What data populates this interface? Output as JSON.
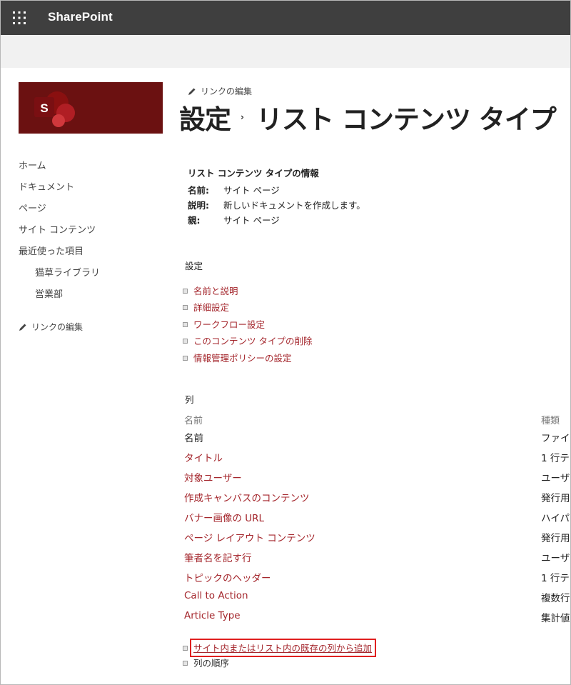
{
  "suite": {
    "app_name": "SharePoint"
  },
  "nav": {
    "items": [
      {
        "label": "ホーム",
        "sub": false
      },
      {
        "label": "ドキュメント",
        "sub": false
      },
      {
        "label": "ページ",
        "sub": false
      },
      {
        "label": "サイト コンテンツ",
        "sub": false
      },
      {
        "label": "最近使った項目",
        "sub": false
      },
      {
        "label": "猫草ライブラリ",
        "sub": true
      },
      {
        "label": "営業部",
        "sub": true
      }
    ],
    "edit_links": "リンクの編集"
  },
  "header": {
    "edit_links": "リンクの編集",
    "breadcrumb_parent": "設定",
    "breadcrumb_separator": "›",
    "breadcrumb_current": "リスト コンテンツ タイプ"
  },
  "info": {
    "title": "リスト コンテンツ タイプの情報",
    "rows": [
      {
        "label": "名前:",
        "value": "サイト ページ"
      },
      {
        "label": "説明:",
        "value": "新しいドキュメントを作成します。"
      },
      {
        "label": "親:",
        "value": "サイト ページ"
      }
    ]
  },
  "settings": {
    "heading": "設定",
    "links": [
      "名前と説明",
      "詳細設定",
      "ワークフロー設定",
      "このコンテンツ タイプの削除",
      "情報管理ポリシーの設定"
    ]
  },
  "columns": {
    "heading": "列",
    "header_name": "名前",
    "header_type": "種類",
    "rows": [
      {
        "name": "名前",
        "type": "ファイル",
        "link": false
      },
      {
        "name": "タイトル",
        "type": "1 行テ",
        "link": true
      },
      {
        "name": "対象ユーザー",
        "type": "ユーザー",
        "link": true
      },
      {
        "name": "作成キャンバスのコンテンツ",
        "type": "発行用",
        "link": true
      },
      {
        "name": "バナー画像の URL",
        "type": "ハイパー",
        "link": true
      },
      {
        "name": "ページ レイアウト コンテンツ",
        "type": "発行用",
        "link": true
      },
      {
        "name": "筆者名を記す行",
        "type": "ユーザー",
        "link": true
      },
      {
        "name": "トピックのヘッダー",
        "type": "1 行テ",
        "link": true
      },
      {
        "name": "Call to Action",
        "type": "複数行",
        "link": true
      },
      {
        "name": "Article Type",
        "type": "集計値",
        "link": true
      }
    ],
    "add_existing": "サイト内またはリスト内の既存の列から追加",
    "column_order": "列の順序"
  },
  "colors": {
    "suitebar": "#3f3f3f",
    "link": "#a4262c",
    "logo_bg": "#6b1111",
    "highlight": "#e02020"
  }
}
